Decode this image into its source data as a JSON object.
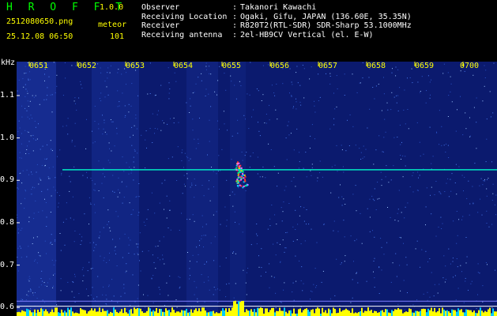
{
  "header": {
    "app_title": "H R O F F T",
    "app_version": "1.0.0",
    "file_name": "2512080650.png",
    "meteor_label": "meteor",
    "datetime": "25.12.08 06:50",
    "meteor_count": "101",
    "separator": ":",
    "info": [
      {
        "label": "Observer",
        "value": "Takanori Kawachi"
      },
      {
        "label": "Receiving Location",
        "value": "Ogaki, Gifu, JAPAN (136.60E, 35.35N)"
      },
      {
        "label": "Receiver",
        "value": "R820T2(RTL-SDR) SDR-Sharp 53.1000MHz"
      },
      {
        "label": "Receiving antenna",
        "value": "2el-HB9CV Vertical (el. E-W)"
      }
    ]
  },
  "colors": {
    "background": "#000000",
    "spectrogram_base": "#0b1a6e",
    "title_color": "#00ff00",
    "label_color": "#ffff00",
    "carrier_color": "#00ffcc",
    "bottom_bar_color": "#ffff00"
  },
  "chart_data": {
    "type": "heatmap",
    "ylabel": "kHz",
    "x_ticks": [
      "0651",
      "0652",
      "0653",
      "0654",
      "0655",
      "0656",
      "0657",
      "0658",
      "0659",
      "0700"
    ],
    "y_ticks": [
      "1.1",
      "1.0",
      "0.9",
      "0.8",
      "0.7",
      "0.6"
    ],
    "ylim": [
      0.58,
      1.18
    ],
    "carrier_freq": 0.925,
    "meteor_echo": {
      "time": "0655",
      "freq_range": [
        0.885,
        0.945
      ]
    }
  }
}
